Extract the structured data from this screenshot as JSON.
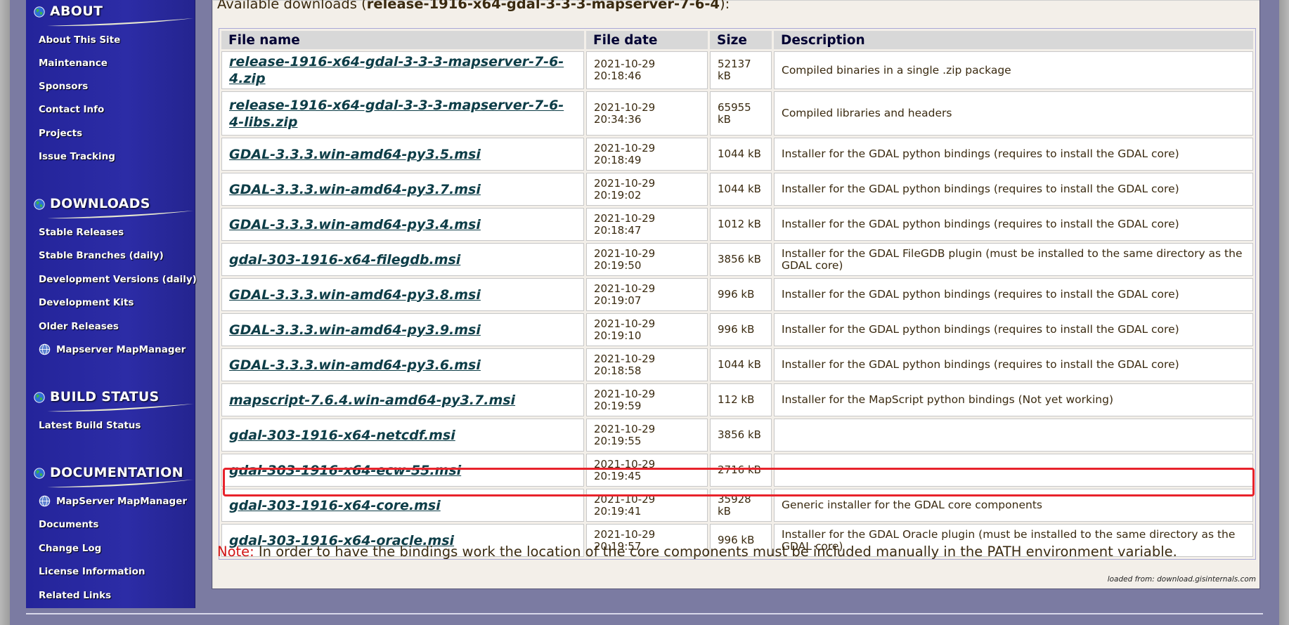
{
  "sidebar": {
    "sections": [
      {
        "title": "ABOUT",
        "items": [
          "About This Site",
          "Maintenance",
          "Sponsors",
          "Contact Info",
          "Projects",
          "Issue Tracking"
        ]
      },
      {
        "title": "DOWNLOADS",
        "items": [
          "Stable Releases",
          "Stable Branches (daily)",
          "Development Versions (daily)",
          "Development Kits",
          "Older Releases",
          "Mapserver MapManager"
        ]
      },
      {
        "title": "BUILD STATUS",
        "items": [
          "Latest Build Status"
        ]
      },
      {
        "title": "DOCUMENTATION",
        "items": [
          "MapServer MapManager",
          "Documents",
          "Change Log",
          "License Information",
          "Related Links"
        ]
      }
    ]
  },
  "main": {
    "heading_prefix": "Available downloads (",
    "heading_release": "release-1916-x64-gdal-3-3-3-mapserver-7-6-4",
    "heading_suffix": "):",
    "columns": [
      "File name",
      "File date",
      "Size",
      "Description"
    ],
    "rows": [
      {
        "name": "release-1916-x64-gdal-3-3-3-mapserver-7-6-4.zip",
        "date": "2021-10-29",
        "time": "20:18:46",
        "size": "52137 kB",
        "desc": "Compiled binaries in a single .zip package"
      },
      {
        "name": "release-1916-x64-gdal-3-3-3-mapserver-7-6-4-libs.zip",
        "date": "2021-10-29",
        "time": "20:34:36",
        "size": "65955 kB",
        "desc": "Compiled libraries and headers"
      },
      {
        "name": "GDAL-3.3.3.win-amd64-py3.5.msi",
        "date": "2021-10-29",
        "time": "20:18:49",
        "size": "1044 kB",
        "desc": "Installer for the GDAL python bindings (requires to install the GDAL core)"
      },
      {
        "name": "GDAL-3.3.3.win-amd64-py3.7.msi",
        "date": "2021-10-29",
        "time": "20:19:02",
        "size": "1044 kB",
        "desc": "Installer for the GDAL python bindings (requires to install the GDAL core)"
      },
      {
        "name": "GDAL-3.3.3.win-amd64-py3.4.msi",
        "date": "2021-10-29",
        "time": "20:18:47",
        "size": "1012 kB",
        "desc": "Installer for the GDAL python bindings (requires to install the GDAL core)"
      },
      {
        "name": "gdal-303-1916-x64-filegdb.msi",
        "date": "2021-10-29",
        "time": "20:19:50",
        "size": "3856 kB",
        "desc": "Installer for the GDAL FileGDB plugin (must be installed to the same directory as the GDAL core)"
      },
      {
        "name": "GDAL-3.3.3.win-amd64-py3.8.msi",
        "date": "2021-10-29",
        "time": "20:19:07",
        "size": "996 kB",
        "desc": "Installer for the GDAL python bindings (requires to install the GDAL core)"
      },
      {
        "name": "GDAL-3.3.3.win-amd64-py3.9.msi",
        "date": "2021-10-29",
        "time": "20:19:10",
        "size": "996 kB",
        "desc": "Installer for the GDAL python bindings (requires to install the GDAL core)"
      },
      {
        "name": "GDAL-3.3.3.win-amd64-py3.6.msi",
        "date": "2021-10-29",
        "time": "20:18:58",
        "size": "1044 kB",
        "desc": "Installer for the GDAL python bindings (requires to install the GDAL core)"
      },
      {
        "name": "mapscript-7.6.4.win-amd64-py3.7.msi",
        "date": "2021-10-29",
        "time": "20:19:59",
        "size": "112 kB",
        "desc": "Installer for the MapScript python bindings (Not yet working)"
      },
      {
        "name": "gdal-303-1916-x64-netcdf.msi",
        "date": "2021-10-29",
        "time": "20:19:55",
        "size": "3856 kB",
        "desc": ""
      },
      {
        "name": "gdal-303-1916-x64-ecw-55.msi",
        "date": "2021-10-29",
        "time": "20:19:45",
        "size": "2716 kB",
        "desc": ""
      },
      {
        "name": "gdal-303-1916-x64-core.msi",
        "date": "2021-10-29",
        "time": "20:19:41",
        "size": "35928 kB",
        "desc": "Generic installer for the GDAL core components"
      },
      {
        "name": "gdal-303-1916-x64-oracle.msi",
        "date": "2021-10-29",
        "time": "20:19:57",
        "size": "996 kB",
        "desc": "Installer for the GDAL Oracle plugin (must be installed to the same directory as the GDAL core)"
      }
    ],
    "note_label": "Note:",
    "note_text": " In order to have the bindings work the location of the core components must be included manually in the PATH environment variable.",
    "loaded_from": "loaded from: download.gisinternals.com"
  },
  "colors": {
    "sidebar_bg": "#2a2a9e",
    "page_bg": "#7b7ba2",
    "link": "#0d3d47",
    "highlight": "#e8232b",
    "note": "#d11414"
  },
  "icons": {
    "section": "globe-icon",
    "swoosh": "swoosh-decoration",
    "nav": "globe-icon"
  }
}
